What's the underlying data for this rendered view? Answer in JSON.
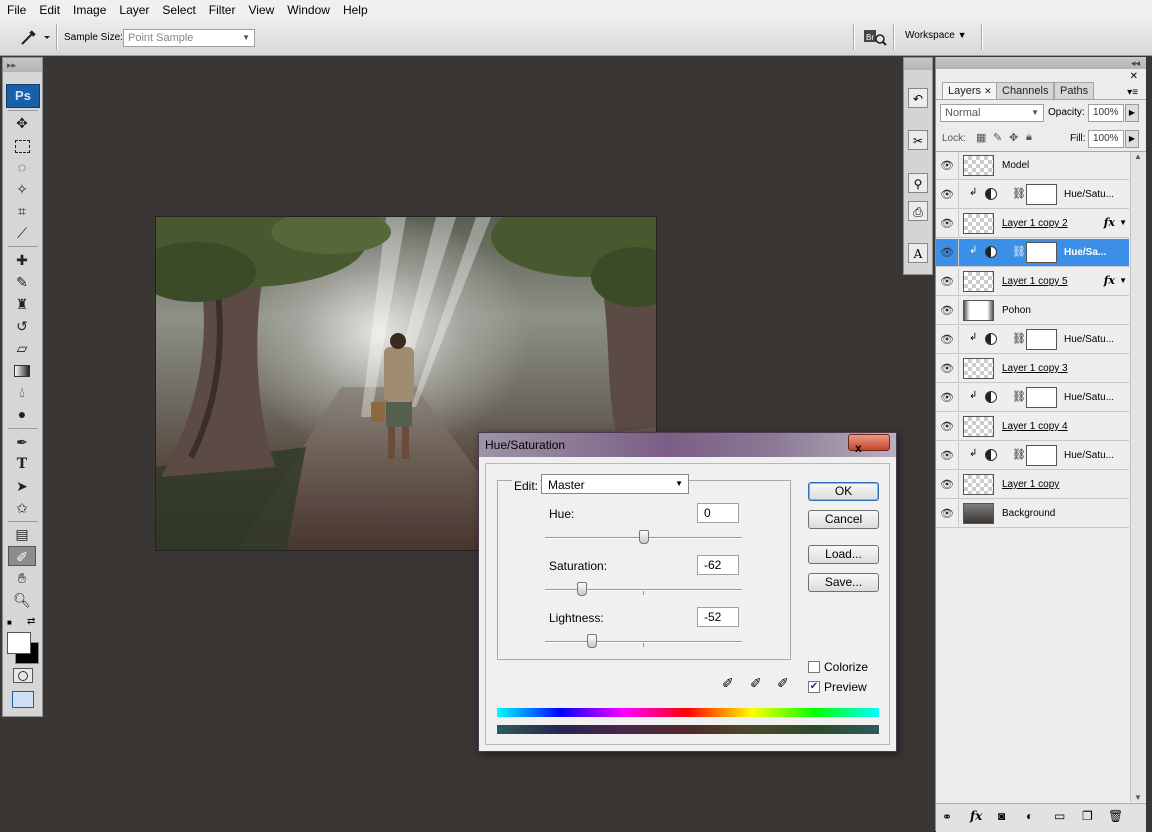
{
  "menu": [
    "File",
    "Edit",
    "Image",
    "Layer",
    "Select",
    "Filter",
    "View",
    "Window",
    "Help"
  ],
  "options_bar": {
    "tool_icon": "eyedropper-icon",
    "sample_size_label": "Sample Size:",
    "sample_size_value": "Point Sample",
    "workspace_label": "Workspace"
  },
  "toolbox": {
    "logo": "Ps",
    "tools": [
      "move",
      "marquee",
      "lasso",
      "magic-wand",
      "crop",
      "slice",
      "healing-brush",
      "brush",
      "clone-stamp",
      "history-brush",
      "eraser",
      "gradient",
      "blur",
      "dodge",
      "pen",
      "type",
      "path-selection",
      "custom-shape",
      "notes",
      "eyedropper",
      "hand",
      "zoom"
    ]
  },
  "layers_panel": {
    "tabs": [
      "Layers",
      "Channels",
      "Paths"
    ],
    "blend_mode": "Normal",
    "opacity_label": "Opacity:",
    "opacity_value": "100%",
    "lock_label": "Lock:",
    "fill_label": "Fill:",
    "fill_value": "100%",
    "layers": [
      {
        "name": "Model",
        "type": "pixel",
        "underline": false,
        "fx": false,
        "selected": false
      },
      {
        "name": "Hue/Satu...",
        "type": "adjustment",
        "underline": false,
        "fx": false,
        "selected": false
      },
      {
        "name": "Layer 1 copy 2",
        "type": "pixel",
        "underline": true,
        "fx": true,
        "selected": false
      },
      {
        "name": "Hue/Sa...",
        "type": "adjustment",
        "underline": false,
        "fx": false,
        "selected": true
      },
      {
        "name": "Layer 1 copy 5",
        "type": "pixel",
        "underline": true,
        "fx": true,
        "selected": false
      },
      {
        "name": "Pohon",
        "type": "pixel",
        "underline": false,
        "fx": false,
        "selected": false
      },
      {
        "name": "Hue/Satu...",
        "type": "adjustment",
        "underline": false,
        "fx": false,
        "selected": false
      },
      {
        "name": "Layer 1 copy 3",
        "type": "pixel",
        "underline": true,
        "fx": false,
        "selected": false
      },
      {
        "name": "Hue/Satu...",
        "type": "adjustment",
        "underline": false,
        "fx": false,
        "selected": false
      },
      {
        "name": "Layer 1 copy 4",
        "type": "pixel",
        "underline": true,
        "fx": false,
        "selected": false
      },
      {
        "name": "Hue/Satu...",
        "type": "adjustment",
        "underline": false,
        "fx": false,
        "selected": false
      },
      {
        "name": "Layer 1 copy",
        "type": "pixel",
        "underline": true,
        "fx": false,
        "selected": false
      },
      {
        "name": "Background",
        "type": "pixel",
        "underline": false,
        "fx": false,
        "selected": false
      }
    ],
    "fx_label": "fx"
  },
  "dialog": {
    "title": "Hue/Saturation",
    "close": "x",
    "edit_label": "Edit:",
    "edit_value": "Master",
    "hue_label": "Hue:",
    "hue_value": "0",
    "saturation_label": "Saturation:",
    "saturation_value": "-62",
    "lightness_label": "Lightness:",
    "lightness_value": "-52",
    "ok": "OK",
    "cancel": "Cancel",
    "load": "Load...",
    "save": "Save...",
    "colorize_label": "Colorize",
    "colorize_checked": false,
    "preview_label": "Preview",
    "preview_checked": true
  }
}
